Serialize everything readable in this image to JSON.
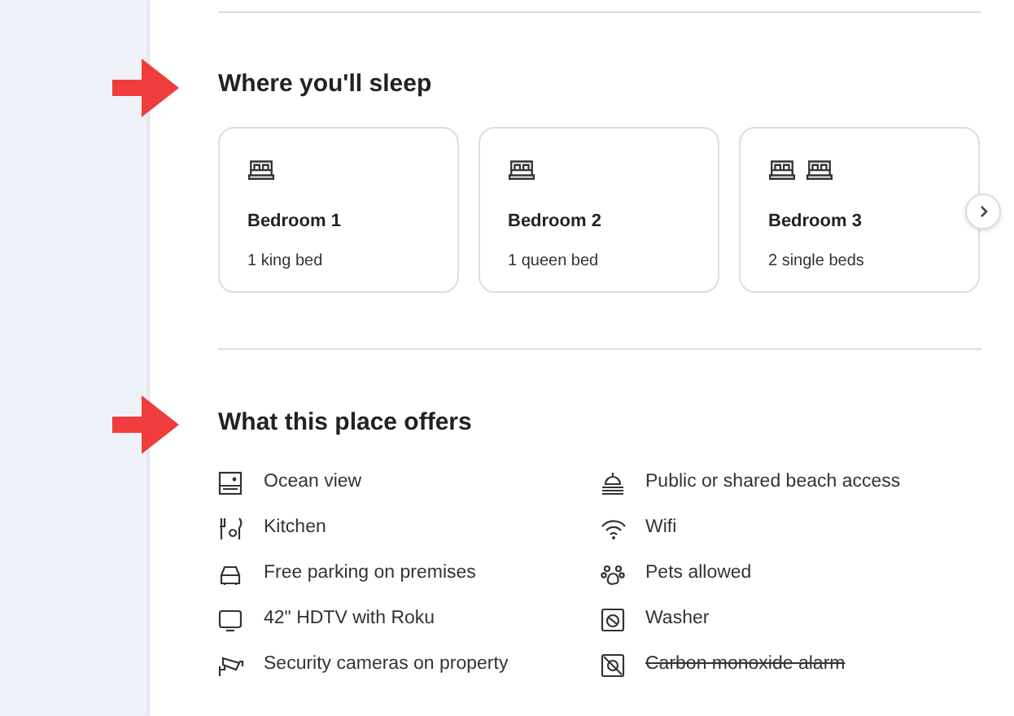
{
  "sleep": {
    "title": "Where you'll sleep",
    "bedrooms": [
      {
        "name": "Bedroom 1",
        "beds": "1 king bed",
        "kind": "one-bed"
      },
      {
        "name": "Bedroom 2",
        "beds": "1 queen bed",
        "kind": "one-bed"
      },
      {
        "name": "Bedroom 3",
        "beds": "2 single beds",
        "kind": "two-beds"
      }
    ]
  },
  "offers": {
    "title": "What this place offers",
    "amenities": [
      {
        "label": "Ocean view",
        "kind": "view",
        "available": true
      },
      {
        "label": "Kitchen",
        "kind": "kitchen",
        "available": true
      },
      {
        "label": "Free parking on premises",
        "kind": "car",
        "available": true
      },
      {
        "label": "42\" HDTV with Roku",
        "kind": "tv",
        "available": true
      },
      {
        "label": "Security cameras on property",
        "kind": "camera",
        "available": true
      },
      {
        "label": "Public or shared beach access",
        "kind": "beach",
        "available": true
      },
      {
        "label": "Wifi",
        "kind": "wifi",
        "available": true
      },
      {
        "label": "Pets allowed",
        "kind": "paw",
        "available": true
      },
      {
        "label": "Washer",
        "kind": "washer",
        "available": true
      },
      {
        "label": "Carbon monoxide alarm",
        "kind": "alarm",
        "available": false
      }
    ]
  }
}
